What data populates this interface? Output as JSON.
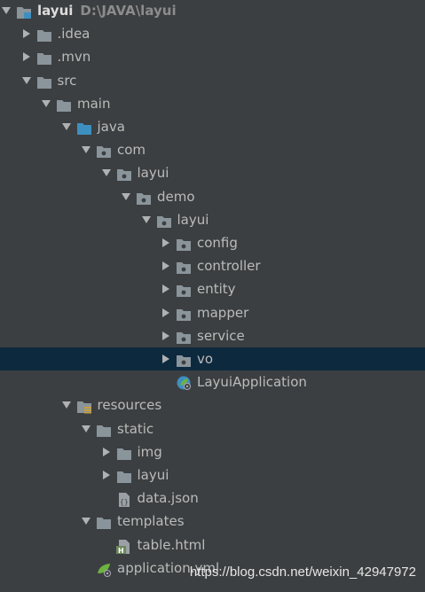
{
  "project": {
    "name": "layui",
    "path": "D:\\JAVA\\layui"
  },
  "tree": [
    {
      "label": "layui",
      "path": "D:\\JAVA\\layui",
      "depth": 0,
      "expanded": true,
      "icon": "project-folder-icon",
      "name": "project-root"
    },
    {
      "label": ".idea",
      "depth": 1,
      "expanded": false,
      "icon": "folder-icon",
      "name": "idea"
    },
    {
      "label": ".mvn",
      "depth": 1,
      "expanded": false,
      "icon": "folder-icon",
      "name": "mvn"
    },
    {
      "label": "src",
      "depth": 1,
      "expanded": true,
      "icon": "folder-icon",
      "name": "src"
    },
    {
      "label": "main",
      "depth": 2,
      "expanded": true,
      "icon": "folder-icon",
      "name": "main"
    },
    {
      "label": "java",
      "depth": 3,
      "expanded": true,
      "icon": "source-folder-icon",
      "name": "java"
    },
    {
      "label": "com",
      "depth": 4,
      "expanded": true,
      "icon": "package-icon",
      "name": "com"
    },
    {
      "label": "layui",
      "depth": 5,
      "expanded": true,
      "icon": "package-icon",
      "name": "com-layui"
    },
    {
      "label": "demo",
      "depth": 6,
      "expanded": true,
      "icon": "package-icon",
      "name": "demo"
    },
    {
      "label": "layui",
      "depth": 7,
      "expanded": true,
      "icon": "package-icon",
      "name": "demo-layui"
    },
    {
      "label": "config",
      "depth": 8,
      "expanded": false,
      "icon": "package-icon",
      "name": "config"
    },
    {
      "label": "controller",
      "depth": 8,
      "expanded": false,
      "icon": "package-icon",
      "name": "controller"
    },
    {
      "label": "entity",
      "depth": 8,
      "expanded": false,
      "icon": "package-icon",
      "name": "entity"
    },
    {
      "label": "mapper",
      "depth": 8,
      "expanded": false,
      "icon": "package-icon",
      "name": "mapper"
    },
    {
      "label": "service",
      "depth": 8,
      "expanded": false,
      "icon": "package-icon",
      "name": "service"
    },
    {
      "label": "vo",
      "depth": 8,
      "expanded": false,
      "icon": "package-icon",
      "name": "vo",
      "selected": true
    },
    {
      "label": "LayuiApplication",
      "depth": 8,
      "leaf": true,
      "icon": "spring-boot-class-icon",
      "name": "layui-application"
    },
    {
      "label": "resources",
      "depth": 3,
      "expanded": true,
      "icon": "resources-folder-icon",
      "name": "resources"
    },
    {
      "label": "static",
      "depth": 4,
      "expanded": true,
      "icon": "folder-icon",
      "name": "static"
    },
    {
      "label": "img",
      "depth": 5,
      "expanded": false,
      "icon": "folder-icon",
      "name": "img"
    },
    {
      "label": "layui",
      "depth": 5,
      "expanded": false,
      "icon": "folder-icon",
      "name": "static-layui"
    },
    {
      "label": "data.json",
      "depth": 5,
      "leaf": true,
      "icon": "json-file-icon",
      "name": "data-json"
    },
    {
      "label": "templates",
      "depth": 4,
      "expanded": true,
      "icon": "folder-icon",
      "name": "templates"
    },
    {
      "label": "table.html",
      "depth": 5,
      "leaf": true,
      "icon": "html-file-icon",
      "name": "table-html"
    },
    {
      "label": "application.yml",
      "depth": 4,
      "leaf": true,
      "icon": "spring-config-file-icon",
      "name": "application-yml"
    }
  ],
  "watermark": "https://blog.csdn.net/weixin_42947972",
  "colors": {
    "background": "#3c3f41",
    "selection": "#0d293e",
    "text": "#bbbbbb",
    "folder": "#8a949b",
    "source_folder": "#3d8fc0"
  }
}
